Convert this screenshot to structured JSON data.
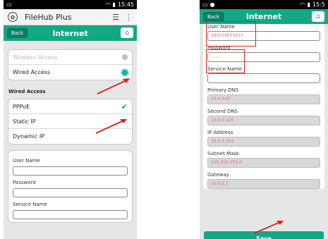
{
  "left": {
    "status": {
      "time": "15:45"
    },
    "app": {
      "name": "FileHub Plus"
    },
    "nav": {
      "back": "Back",
      "title": "Internet"
    },
    "access": {
      "items": [
        {
          "label": "Wireless Access",
          "selected": false
        },
        {
          "label": "Wired Access",
          "selected": true
        }
      ]
    },
    "wired": {
      "section": "Wired Access",
      "items": [
        {
          "label": "PPPoE",
          "checked": true
        },
        {
          "label": "Static IP",
          "checked": false
        },
        {
          "label": "Dynamic IP",
          "checked": false
        }
      ]
    },
    "form": {
      "user_name": "User Name",
      "password": "Password",
      "service_name": "Service Name"
    }
  },
  "right": {
    "status": {
      "time": "15:5"
    },
    "nav": {
      "back": "Back",
      "title": "Internet"
    },
    "fields": [
      {
        "label": "User Name",
        "value": "280014653423",
        "readonly": false
      },
      {
        "label": "Password",
        "value": "........",
        "readonly": false
      },
      {
        "label": "Service Name",
        "value": "",
        "readonly": false
      },
      {
        "label": "Primary DNS",
        "value": "10.0.0.87",
        "readonly": true
      },
      {
        "label": "Second DNS",
        "value": "10.0.0.125",
        "readonly": true
      },
      {
        "label": "IP Address",
        "value": "10.0.2.101",
        "readonly": true
      },
      {
        "label": "Subnet Mask",
        "value": "255.255.255.0",
        "readonly": true
      },
      {
        "label": "Gateway",
        "value": "10.0.2.1",
        "readonly": true
      }
    ],
    "save": "Save"
  },
  "colors": {
    "accent": "#12a886",
    "highlight": "#e02020"
  }
}
